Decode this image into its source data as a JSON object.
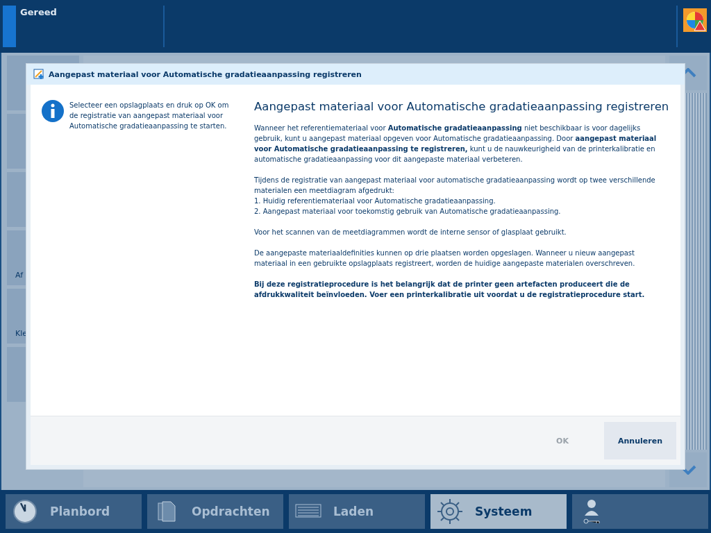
{
  "status_bar": {
    "status": "Gereed"
  },
  "sidebar": {
    "items": [
      {
        "label": "Af"
      },
      {
        "label": "Kle"
      }
    ]
  },
  "dialog": {
    "title": "Aangepast materiaal voor Automatische gradatieaanpassing registreren",
    "instruction": "Selecteer een opslagplaats en druk op OK om de registratie van aangepast materiaal voor Automatische gradatieaanpassing te starten.",
    "heading": "Aangepast materiaal voor Automatische gradatieaanpassing registreren",
    "paragraphs": [
      {
        "kind": "text",
        "text": "Wanneer het referentiemateriaal voor **Automatische gradatieaanpassing** niet beschikbaar is voor dagelijks gebruik, kunt u aangepast materiaal opgeven voor Automatische gradatieaanpassing. Door **aangepast materiaal voor Automatische gradatieaanpassing te registreren,** kunt u de nauwkeurigheid van de printerkalibratie en automatische gradatieaanpassing voor dit aangepaste materiaal verbeteren."
      },
      {
        "kind": "lines",
        "lines": [
          "Tijdens de registratie van aangepast materiaal voor automatische gradatieaanpassing wordt op twee verschillende materialen een meetdiagram afgedrukt:",
          "1. Huidig referentiemateriaal voor Automatische gradatieaanpassing.",
          "2. Aangepast materiaal voor toekomstig gebruik van Automatische gradatieaanpassing."
        ]
      },
      {
        "kind": "text",
        "text": "Voor het scannen van de meetdiagrammen wordt de interne sensor of glasplaat gebruikt."
      },
      {
        "kind": "text",
        "text": "De aangepaste materiaaldefinities kunnen op drie plaatsen worden opgeslagen. Wanneer u nieuw aangepast materiaal in een gebruikte opslagplaats registreert, worden de huidige aangepaste materialen overschreven."
      },
      {
        "kind": "strong",
        "text": "Bij deze registratieprocedure is het belangrijk dat de printer geen artefacten produceert die de afdrukkwaliteit beïnvloeden. Voer een printerkalibratie uit voordat u de registratieprocedure start."
      }
    ],
    "buttons": [
      {
        "label": "OK",
        "disabled": true
      },
      {
        "label": "Annuleren",
        "disabled": false
      }
    ]
  },
  "tabs": [
    {
      "label": "Planbord",
      "selected": false
    },
    {
      "label": "Opdrachten",
      "selected": false
    },
    {
      "label": "Laden",
      "selected": false
    },
    {
      "label": "Systeem",
      "selected": true
    },
    {
      "selected": false
    }
  ]
}
